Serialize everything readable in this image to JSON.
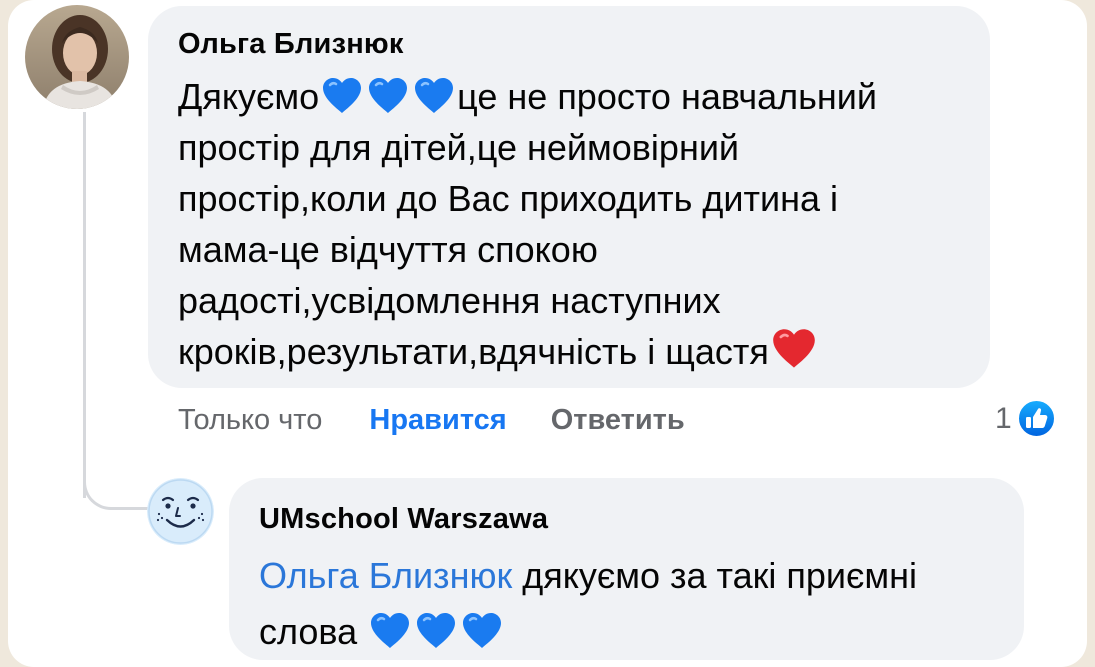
{
  "colors": {
    "page_background": "#efe8dc",
    "card_background": "#ffffff",
    "bubble_background": "#f0f2f5",
    "link_blue": "#1877f2",
    "mention_blue": "#2b77d9",
    "muted_text": "#65676b",
    "heart_blue": "#1a7bf0",
    "heart_red": "#e4282f"
  },
  "comment": {
    "author": "Ольга Близнюк",
    "avatar_icon": "user-avatar-photo",
    "text_parts": [
      "Дякуємо",
      "це не просто навчальний\nпростір для дітей,це неймовірний\nпростір,коли до Вас приходить дитина і\nмама-це відчуття спокою\nрадості,усвідомлення наступних\nкроків,результати,вдячність і щастя"
    ],
    "inline_icons": [
      "blue-heart-emoji",
      "blue-heart-emoji",
      "blue-heart-emoji",
      "red-heart-emoji"
    ],
    "actions": {
      "time": "Только что",
      "like": "Нравится",
      "reply": "Ответить"
    },
    "reactions": {
      "count": "1",
      "icon": "like-reaction-icon"
    }
  },
  "reply": {
    "author": "UMschool Warszawa",
    "avatar_icon": "smiling-face-logo",
    "mention": "Ольга Близнюк",
    "text": " дякуємо за такі приємні\nслова",
    "inline_icons": [
      "blue-heart-emoji",
      "blue-heart-emoji",
      "blue-heart-emoji"
    ]
  }
}
